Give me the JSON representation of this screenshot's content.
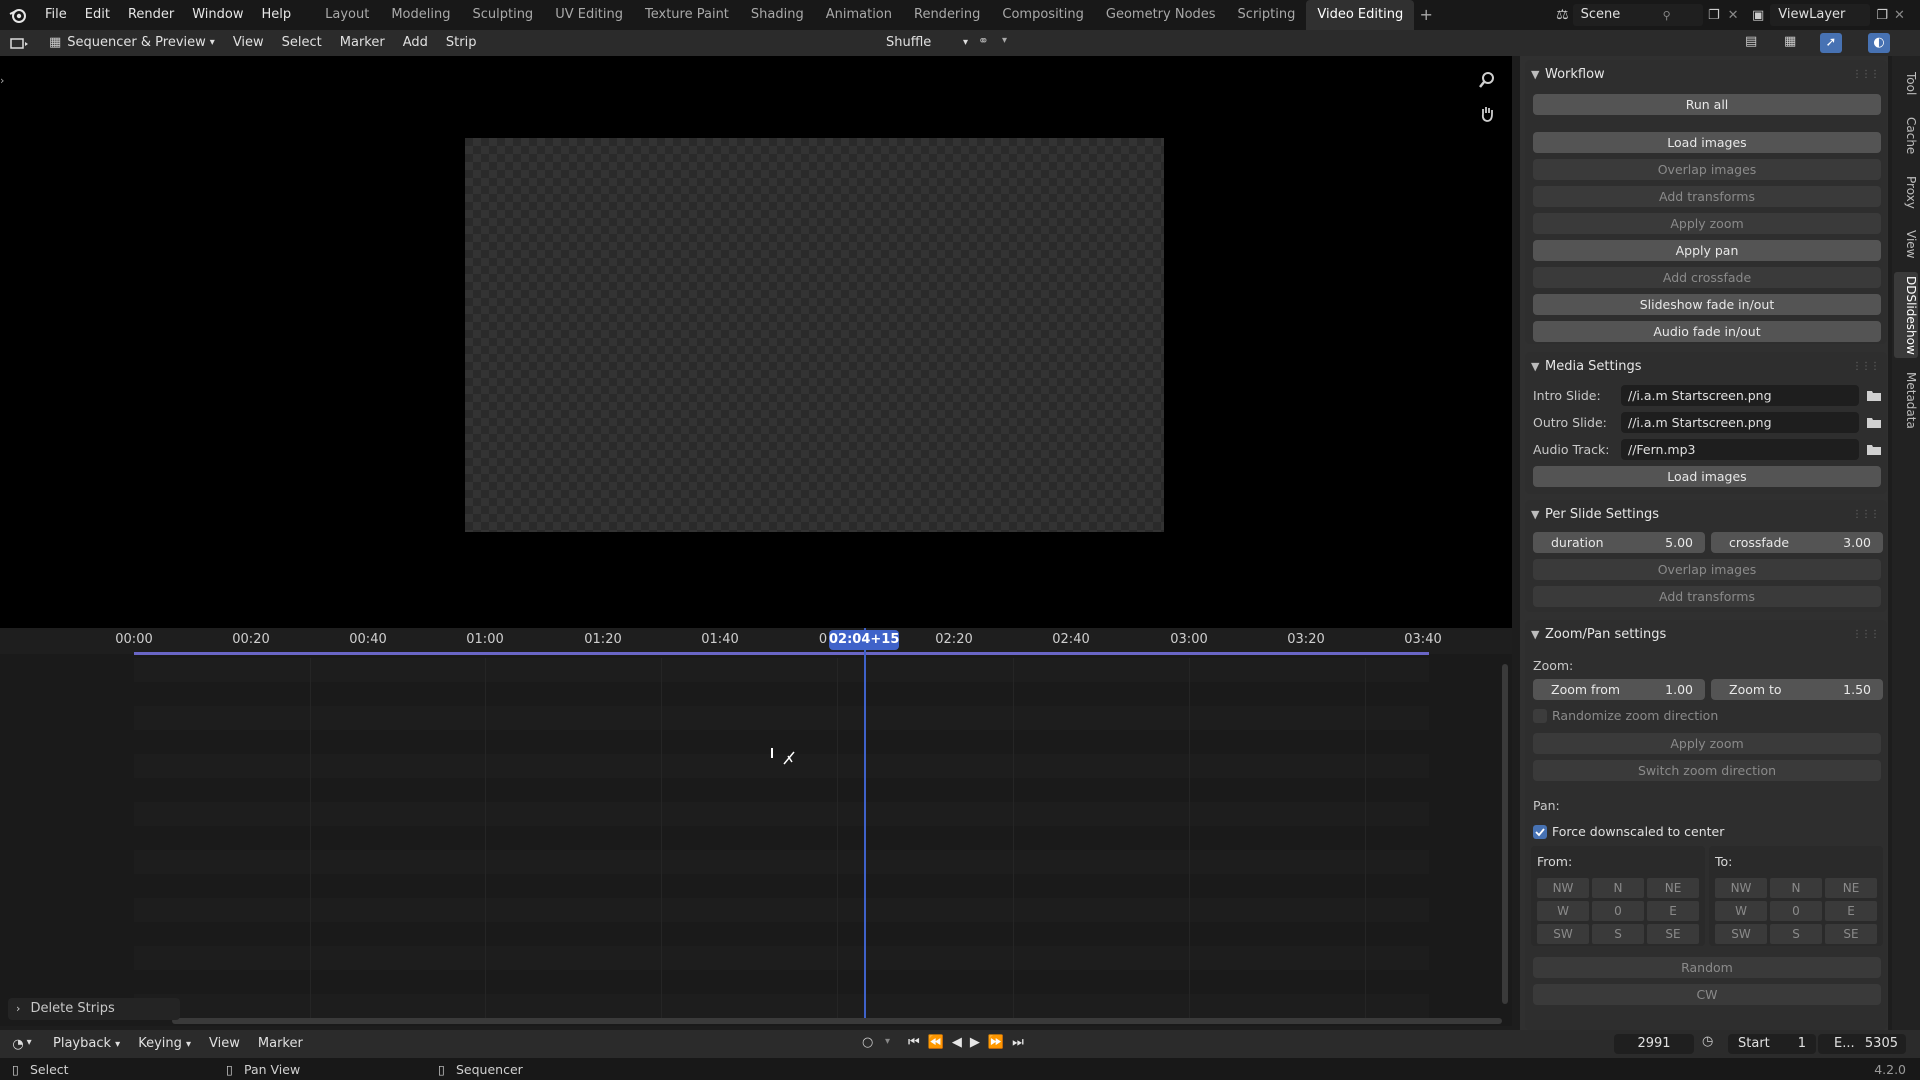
{
  "top_menu": [
    "File",
    "Edit",
    "Render",
    "Window",
    "Help"
  ],
  "workspaces": [
    {
      "label": "Layout"
    },
    {
      "label": "Modeling"
    },
    {
      "label": "Sculpting"
    },
    {
      "label": "UV Editing"
    },
    {
      "label": "Texture Paint"
    },
    {
      "label": "Shading"
    },
    {
      "label": "Animation"
    },
    {
      "label": "Rendering"
    },
    {
      "label": "Compositing"
    },
    {
      "label": "Geometry Nodes"
    },
    {
      "label": "Scripting"
    },
    {
      "label": "Video Editing"
    }
  ],
  "workspace_add": "+",
  "scene": {
    "label": "Scene",
    "view_layer": "ViewLayer"
  },
  "header": {
    "editor_mode": "Sequencer & Preview",
    "menus": [
      "View",
      "Select",
      "Marker",
      "Add",
      "Strip"
    ],
    "overlap_mode": "Shuffle"
  },
  "timeline": {
    "ticks": [
      "00:00",
      "00:20",
      "00:40",
      "01:00",
      "01:20",
      "01:40",
      "0",
      "02:20",
      "02:40",
      "03:00",
      "03:20",
      "03:40"
    ],
    "current_time": "02:04+15",
    "delete_strips": "Delete Strips"
  },
  "bottom_header": {
    "menus": [
      "Playback",
      "Keying",
      "View",
      "Marker"
    ],
    "current_frame": "2991",
    "start_label": "Start",
    "start_value": "1",
    "end_label": "E...",
    "end_value": "5305"
  },
  "status": {
    "select": "Select",
    "pan_view": "Pan View",
    "sequencer": "Sequencer",
    "version": "4.2.0"
  },
  "vertical_tabs": [
    "Tool",
    "Cache",
    "Proxy",
    "View",
    "DDSlideshow",
    "Metadata"
  ],
  "workflow": {
    "title": "Workflow",
    "run_all": "Run all",
    "buttons": [
      "Load images",
      "Overlap images",
      "Add transforms",
      "Apply zoom",
      "Apply pan",
      "Add crossfade",
      "Slideshow fade in/out",
      "Audio fade in/out"
    ]
  },
  "media": {
    "title": "Media Settings",
    "intro_label": "Intro Slide:",
    "intro_value": "//i.a.m Startscreen.png",
    "outro_label": "Outro Slide:",
    "outro_value": "//i.a.m Startscreen.png",
    "audio_label": "Audio Track:",
    "audio_value": "//Fern.mp3",
    "load_images": "Load images"
  },
  "per_slide": {
    "title": "Per Slide Settings",
    "duration_label": "duration",
    "duration_value": "5.00",
    "crossfade_label": "crossfade",
    "crossfade_value": "3.00",
    "overlap": "Overlap images",
    "add_transforms": "Add transforms"
  },
  "zoom_pan": {
    "title": "Zoom/Pan settings",
    "zoom_label": "Zoom:",
    "zoom_from_label": "Zoom from",
    "zoom_from_value": "1.00",
    "zoom_to_label": "Zoom to",
    "zoom_to_value": "1.50",
    "randomize": "Randomize zoom direction",
    "apply_zoom": "Apply zoom",
    "switch_zoom": "Switch zoom direction",
    "pan_label": "Pan:",
    "force_downscaled": "Force downscaled to center",
    "from_label": "From:",
    "to_label": "To:",
    "grid": [
      "NW",
      "N",
      "NE",
      "W",
      "0",
      "E",
      "SW",
      "S",
      "SE"
    ],
    "random": "Random",
    "cw": "CW"
  },
  "colors": {
    "accent": "#4772b3",
    "playhead": "#3f62c9",
    "range": "#6a66c6"
  }
}
